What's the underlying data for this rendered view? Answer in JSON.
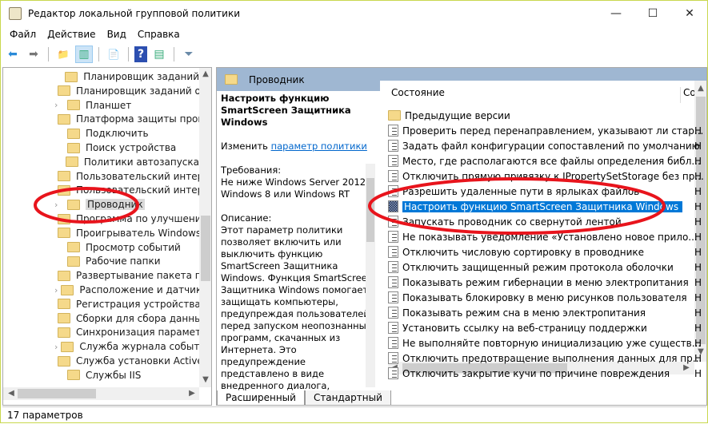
{
  "window": {
    "title": "Редактор локальной групповой политики",
    "minimize": "—",
    "maximize": "☐",
    "close": "✕",
    "border_color": "#c9d84e"
  },
  "menu": [
    "Файл",
    "Действие",
    "Вид",
    "Справка"
  ],
  "toolbar": [
    {
      "icon": "back-arrow-icon",
      "glyph": "⬅"
    },
    {
      "icon": "forward-arrow-icon",
      "glyph": "➡"
    },
    {
      "icon": "up-folder-icon",
      "glyph": "📁"
    },
    {
      "icon": "show-hide-tree-icon",
      "glyph": "▥"
    },
    {
      "icon": "export-list-icon",
      "glyph": "📄"
    },
    {
      "icon": "help-icon",
      "glyph": "?"
    },
    {
      "icon": "show-action-pane-icon",
      "glyph": "▤"
    },
    {
      "icon": "filter-icon",
      "glyph": "⏷"
    }
  ],
  "tree": {
    "items": [
      {
        "label": "Планировщик заданий",
        "expandable": false
      },
      {
        "label": "Планировщик заданий об",
        "expandable": false
      },
      {
        "label": "Планшет",
        "expandable": true
      },
      {
        "label": "Платформа защиты прогр",
        "expandable": false
      },
      {
        "label": "Подключить",
        "expandable": false
      },
      {
        "label": "Поиск устройства",
        "expandable": false
      },
      {
        "label": "Политики автозапуска",
        "expandable": false
      },
      {
        "label": "Пользовательский интерф",
        "expandable": false
      },
      {
        "label": "Пользовательский интерф",
        "expandable": false
      },
      {
        "label": "Проводник",
        "expandable": true,
        "selected": true
      },
      {
        "label": "Программа по улучшени",
        "expandable": false
      },
      {
        "label": "Проигрыватель Windows",
        "expandable": false
      },
      {
        "label": "Просмотр событий",
        "expandable": false
      },
      {
        "label": "Рабочие папки",
        "expandable": false
      },
      {
        "label": "Развертывание пакета при",
        "expandable": false
      },
      {
        "label": "Расположение и датчики",
        "expandable": true
      },
      {
        "label": "Регистрация устройства",
        "expandable": false
      },
      {
        "label": "Сборки для сбора данных",
        "expandable": false
      },
      {
        "label": "Синхронизация параметр",
        "expandable": false
      },
      {
        "label": "Служба журнала событий",
        "expandable": true
      },
      {
        "label": "Служба установки ActiveX",
        "expandable": false
      },
      {
        "label": "Службы IIS",
        "expandable": false
      }
    ]
  },
  "right": {
    "header": "Проводник",
    "description": {
      "title": "Настроить функцию SmartScreen Защитника Windows",
      "edit_prefix": "Изменить ",
      "edit_link": "параметр политики",
      "requirements_label": "Требования:",
      "requirements": "Не ниже Windows Server 2012, Windows 8 или Windows RT",
      "description_label": "Описание:",
      "description": "Этот параметр политики позволяет включить или выключить функцию SmartScreen Защитника Windows. Функция SmartScreen Защитника Windows помогает защищать компьютеры, предупреждая пользователей перед запуском неопознанных программ, скачанных из Интернета. Это предупреждение представлено в виде внедренного диалога, показанного перед запуском"
    },
    "list": {
      "columns": [
        "Состояние",
        "Со"
      ],
      "rows": [
        {
          "label": "Предыдущие версии",
          "type": "folder",
          "state": ""
        },
        {
          "label": "Проверить перед перенаправлением, указывают ли стар...",
          "type": "policy",
          "state": "Н"
        },
        {
          "label": "Задать файл конфигурации сопоставлений по умолчанию",
          "type": "policy",
          "state": "Н"
        },
        {
          "label": "Место, где располагаются все файлы определения библ...",
          "type": "policy",
          "state": "Н"
        },
        {
          "label": "Отключить прямую привязку к IPropertySetStorage без пр...",
          "type": "policy",
          "state": "Н"
        },
        {
          "label": "Разрешить удаленные пути в ярлыках файлов",
          "type": "policy",
          "state": "Н"
        },
        {
          "label": "Настроить функцию SmartScreen Защитника Windows",
          "type": "policy",
          "state": "Н",
          "selected": true
        },
        {
          "label": "Запускать проводник со свернутой лентой",
          "type": "policy",
          "state": "Н"
        },
        {
          "label": "Не показывать уведомление «Установлено новое прило...",
          "type": "policy",
          "state": "Н"
        },
        {
          "label": "Отключить числовую сортировку в проводнике",
          "type": "policy",
          "state": "Н"
        },
        {
          "label": "Отключить защищенный режим протокола оболочки",
          "type": "policy",
          "state": "Н"
        },
        {
          "label": "Показывать режим гибернации в меню электропитания",
          "type": "policy",
          "state": "Н"
        },
        {
          "label": "Показывать блокировку в меню рисунков пользователя",
          "type": "policy",
          "state": "Н"
        },
        {
          "label": "Показывать режим сна в меню электропитания",
          "type": "policy",
          "state": "Н"
        },
        {
          "label": "Установить ссылку на веб-страницу поддержки",
          "type": "policy",
          "state": "Н"
        },
        {
          "label": "Не выполняйте повторную инициализацию уже существ...",
          "type": "policy",
          "state": "Н"
        },
        {
          "label": "Отключить предотвращение выполнения данных для пр...",
          "type": "policy",
          "state": "Н"
        },
        {
          "label": "Отключить закрытие кучи по причине повреждения",
          "type": "policy",
          "state": "Н"
        }
      ],
      "selected_color": "#0078d7"
    },
    "tabs": [
      "Расширенный",
      "Стандартный"
    ]
  },
  "status": "17 параметров",
  "annotation_color": "#e8141c"
}
